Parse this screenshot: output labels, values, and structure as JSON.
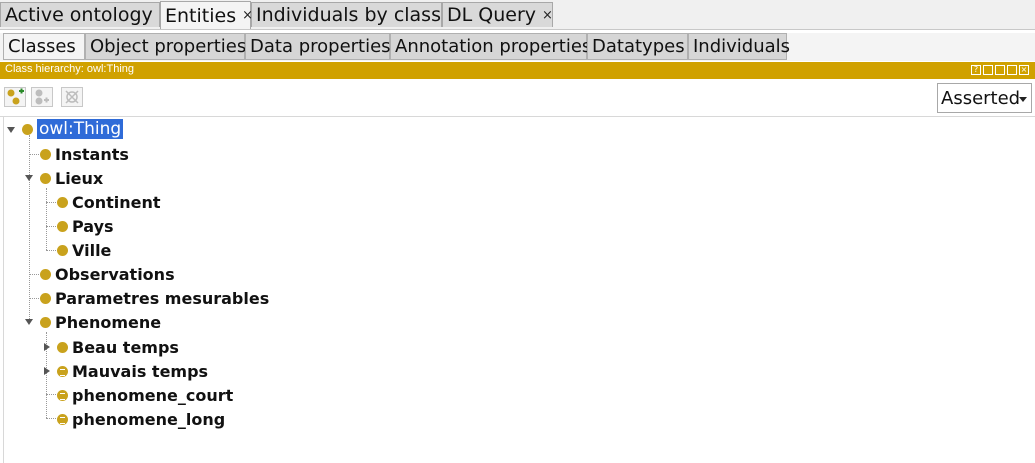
{
  "tabs": [
    {
      "label": "Active ontology",
      "close": "×"
    },
    {
      "label": "Entities",
      "close": "×"
    },
    {
      "label": "Individuals by class",
      "close": "×"
    },
    {
      "label": "DL Query",
      "close": "×"
    }
  ],
  "subtabs": [
    "Classes",
    "Object properties",
    "Data properties",
    "Annotation properties",
    "Datatypes",
    "Individuals"
  ],
  "view": {
    "title": "Class hierarchy: owl:Thing"
  },
  "toolbar": {
    "buttons": [
      "add-subclass-icon",
      "add-sibling-icon",
      "delete-class-icon"
    ],
    "mode": "Asserted"
  },
  "tree": {
    "root": "owl:Thing",
    "nodes": [
      {
        "label": "Instants"
      },
      {
        "label": "Lieux"
      },
      {
        "label": "Continent"
      },
      {
        "label": "Pays"
      },
      {
        "label": "Ville"
      },
      {
        "label": "Observations"
      },
      {
        "label": "Parametres mesurables"
      },
      {
        "label": "Phenomene"
      },
      {
        "label": "Beau temps"
      },
      {
        "label": "Mauvais temps"
      },
      {
        "label": "phenomene_court"
      },
      {
        "label": "phenomene_long"
      }
    ]
  },
  "colors": {
    "accent": "#d0a100",
    "selection": "#2f6bd8",
    "class_dot": "#c9a21d"
  }
}
